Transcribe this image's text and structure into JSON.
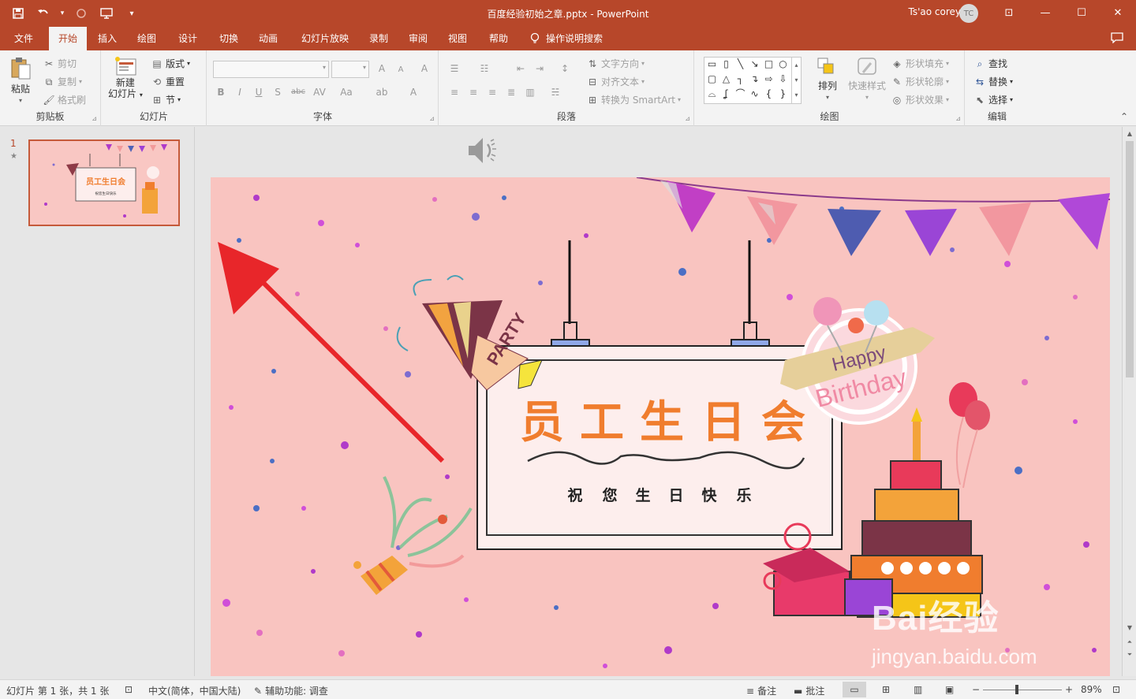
{
  "window": {
    "title": "百度经验初始之章.pptx  -  PowerPoint",
    "user_name": "Ts'ao corey",
    "user_initials": "TC",
    "controls": {
      "restore_ribbon": "⊡",
      "minimize": "—",
      "maximize": "☐",
      "close": "✕"
    }
  },
  "quick_access": {
    "save": "💾",
    "undo": "↶",
    "redo": "↷",
    "present": "▣",
    "customize": "▾"
  },
  "tabs": [
    "文件",
    "开始",
    "插入",
    "绘图",
    "设计",
    "切换",
    "动画",
    "幻灯片放映",
    "录制",
    "审阅",
    "视图",
    "帮助"
  ],
  "active_tab": "开始",
  "tell_me": "操作说明搜索",
  "ribbon": {
    "clipboard": {
      "label": "剪贴板",
      "paste": "粘贴",
      "cut": "剪切",
      "copy": "复制",
      "format_painter": "格式刷"
    },
    "slides": {
      "label": "幻灯片",
      "new_slide_line1": "新建",
      "new_slide_line2": "幻灯片",
      "layout": "版式",
      "reset": "重置",
      "section": "节"
    },
    "font": {
      "label": "字体",
      "grow": "A",
      "shrink": "A",
      "clear": "A",
      "bold": "B",
      "italic": "I",
      "underline": "U",
      "shadow": "S",
      "strike": "abc",
      "spacing": "AV",
      "case": "Aa",
      "highlight": "ab",
      "color": "A"
    },
    "paragraph": {
      "label": "段落",
      "text_direction": "文字方向",
      "align_text": "对齐文本",
      "convert_smartart": "转换为 SmartArt"
    },
    "drawing": {
      "label": "绘图",
      "arrange": "排列",
      "quick_styles": "快速样式",
      "shape_fill": "形状填充",
      "shape_outline": "形状轮廓",
      "shape_effects": "形状效果"
    },
    "editing": {
      "label": "编辑",
      "find": "查找",
      "replace": "替换",
      "select": "选择"
    }
  },
  "thumbnail": {
    "number": "1",
    "star": "★",
    "title": "员工生日会",
    "subtitle": "祝您生日快乐"
  },
  "slide": {
    "title_chars": [
      "员",
      "工",
      "生",
      "日",
      "会"
    ],
    "subtitle_chars": [
      "祝",
      "您",
      "生",
      "日",
      "快",
      "乐"
    ],
    "party_label": "PARTY",
    "badge_line1": "Happy",
    "badge_line2": "Birthday"
  },
  "status": {
    "slide_info": "幻灯片 第 1 张，共 1 张",
    "language": "中文(简体，中国大陆)",
    "accessibility": "辅助功能: 调查",
    "notes": "备注",
    "comments": "批注",
    "zoom": "89%"
  },
  "watermark": {
    "line1": "Bai经验",
    "line2": "jingyan.baidu.com"
  },
  "colors": {
    "accent": "#b7472a",
    "slide_bg": "#f9c4c0",
    "title_orange": "#f07d2e",
    "arrow_red": "#e8262a"
  }
}
